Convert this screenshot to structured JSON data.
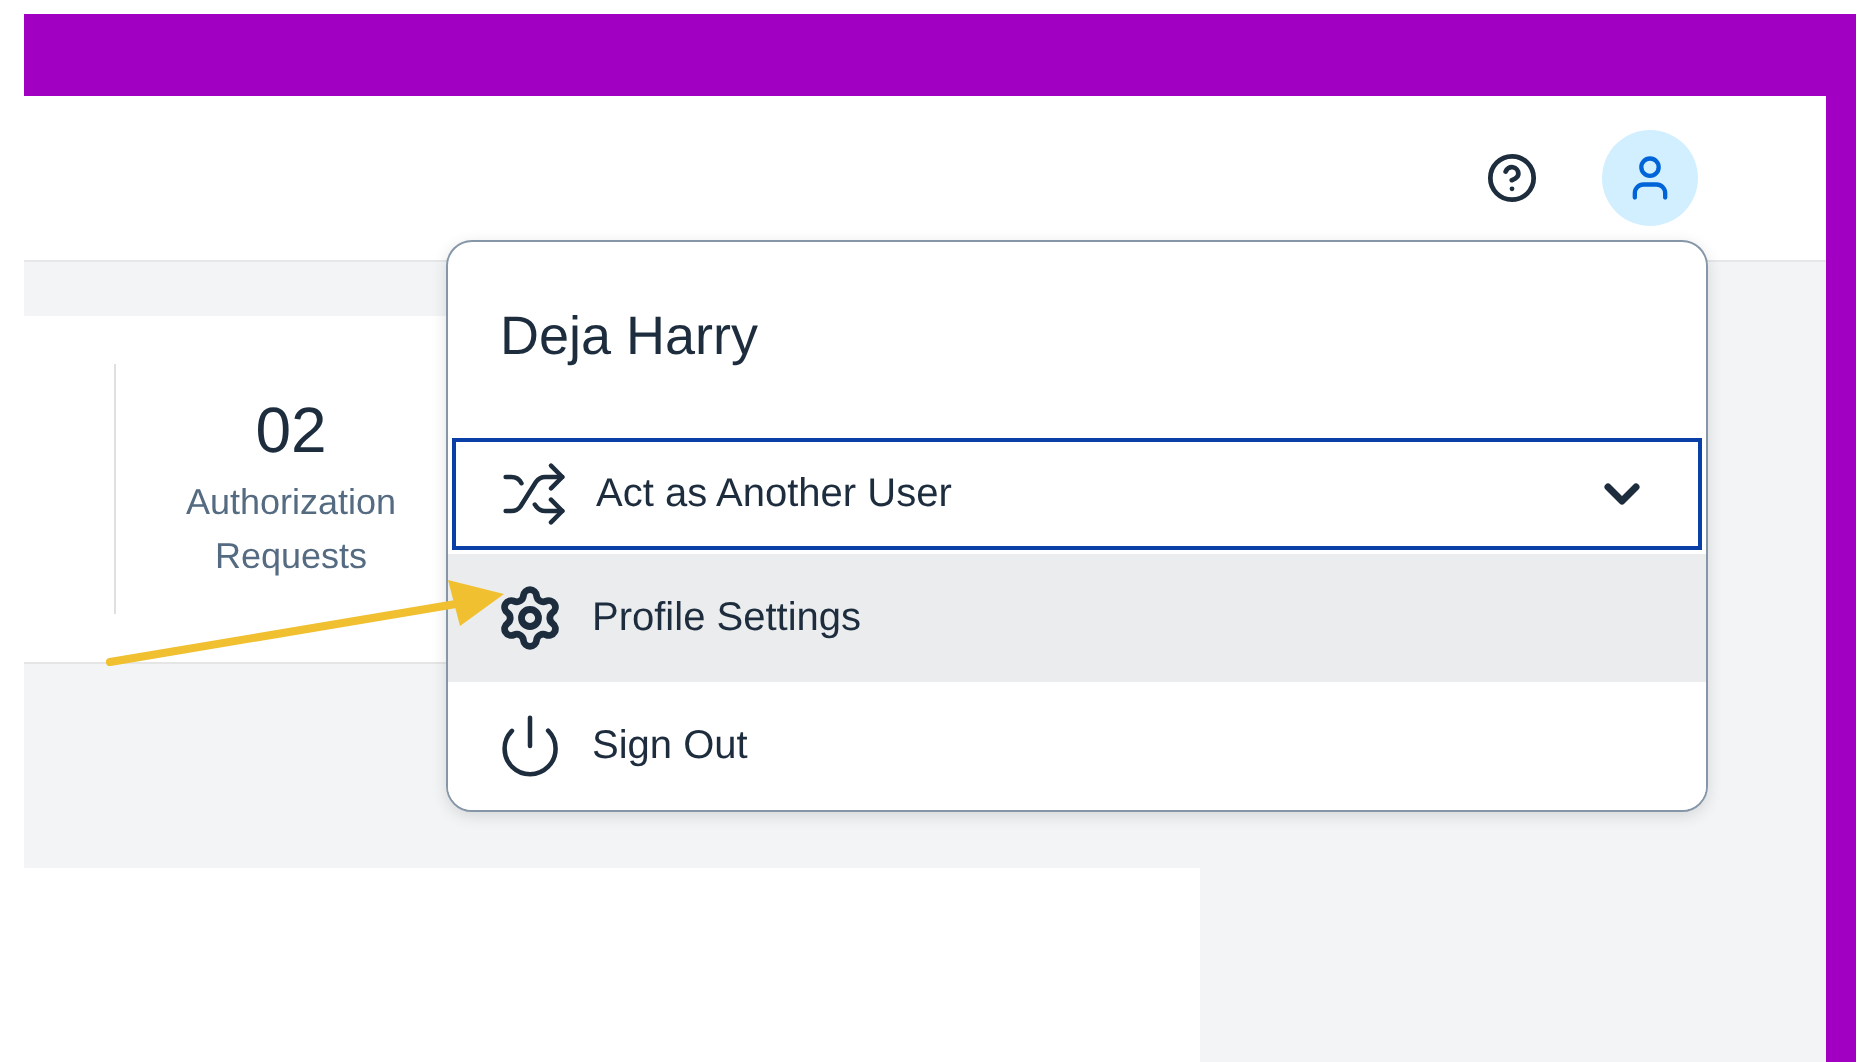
{
  "tile": {
    "count": "02",
    "label": "Authorization Requests"
  },
  "user_menu": {
    "name": "Deja Harry",
    "items": [
      {
        "kind": "switch",
        "label": "Act as Another User",
        "focused": true,
        "selected": false,
        "expandable": true
      },
      {
        "kind": "settings",
        "label": "Profile Settings",
        "focused": false,
        "selected": true,
        "expandable": false
      },
      {
        "kind": "signout",
        "label": "Sign Out",
        "focused": false,
        "selected": false,
        "expandable": false
      }
    ]
  }
}
